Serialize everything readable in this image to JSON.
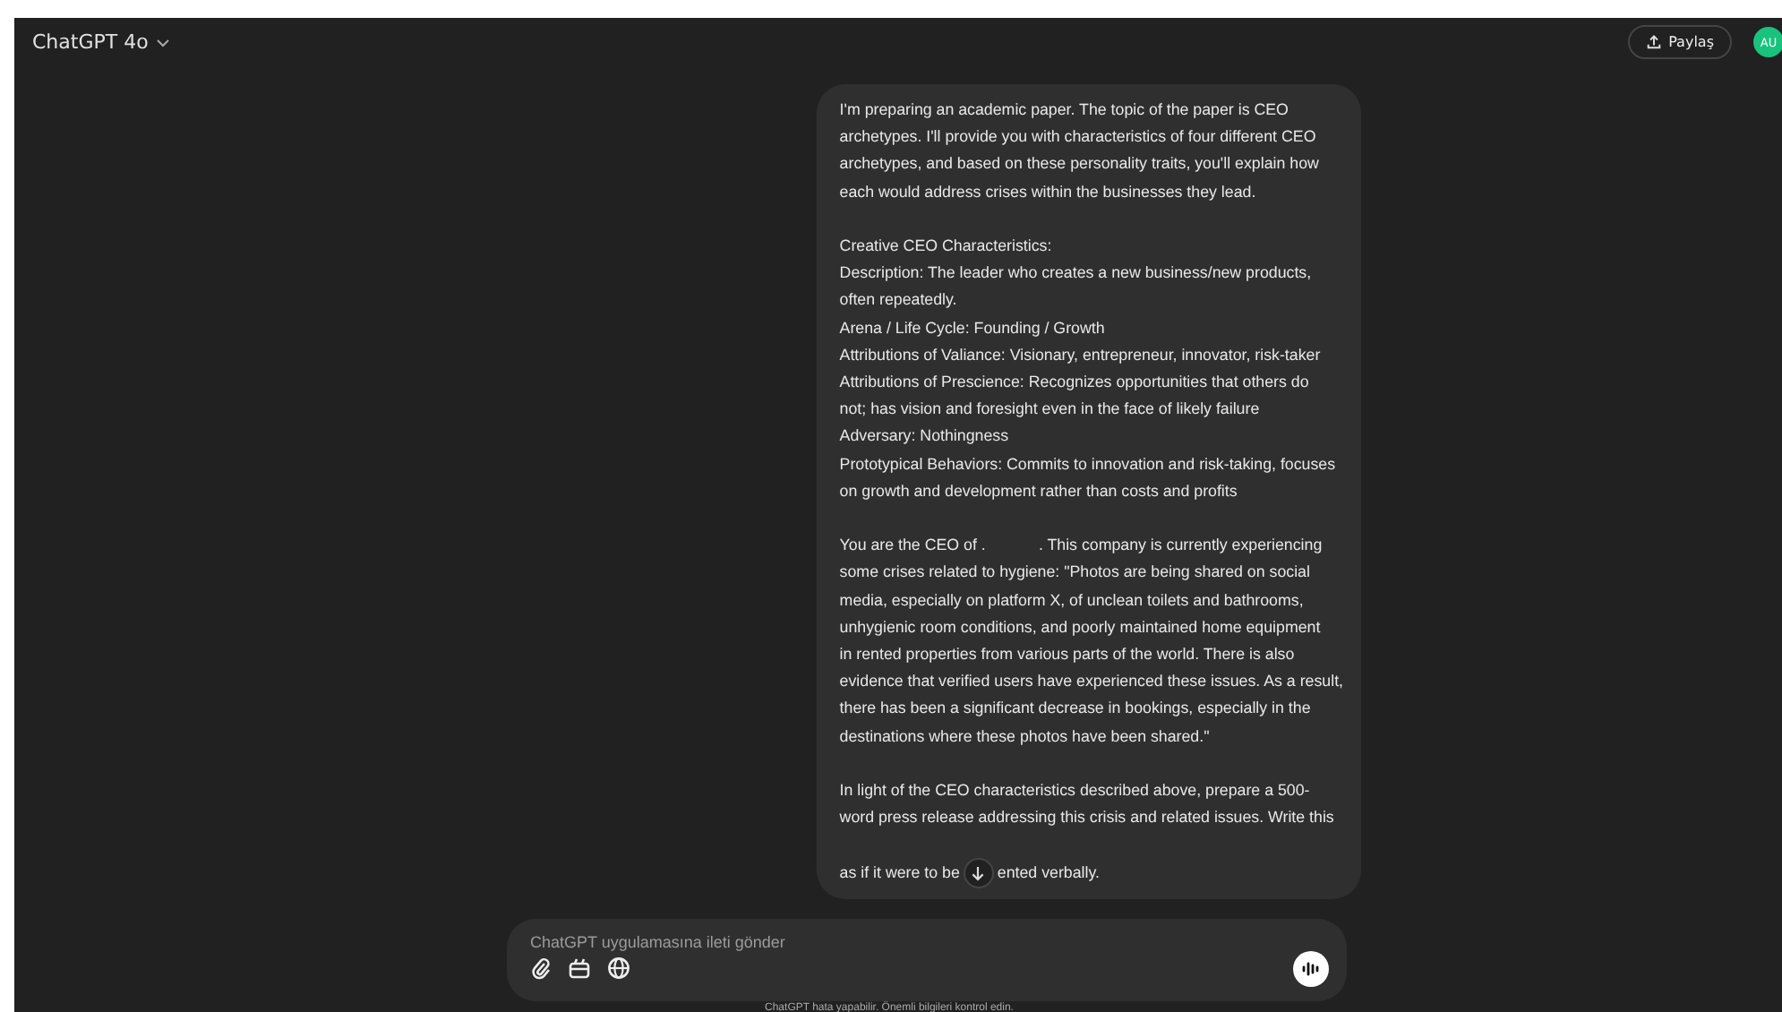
{
  "header": {
    "model": "ChatGPT 4o",
    "share": "Paylaş",
    "avatar": "AU"
  },
  "message": {
    "paragraphs": [
      [
        "I'm preparing an academic paper. The topic of the paper is CEO",
        "archetypes. I'll provide you with characteristics of four different CEO",
        "archetypes, and based on these personality traits, you'll explain how",
        "each would address crises within the businesses they lead."
      ],
      [
        "Creative CEO Characteristics:",
        "Description: The leader who creates a new business/new products,",
        "often repeatedly.",
        "Arena / Life Cycle: Founding / Growth",
        "Attributions of Valiance: Visionary, entrepreneur, innovator, risk-taker",
        "Attributions of Prescience: Recognizes opportunities that others do",
        "not; has vision and foresight even in the face of likely failure",
        "Adversary: Nothingness",
        "Prototypical Behaviors: Commits to innovation and risk-taking, focuses",
        "on growth and development rather than costs and profits"
      ],
      [
        "You are the CEO of .            . This company is currently experiencing",
        "some crises related to hygiene: \"Photos are being shared on social",
        "media, especially on platform X, of unclean toilets and bathrooms,",
        "unhygienic room conditions, and poorly maintained home equipment",
        "in rented properties from various parts of the world. There is also",
        "evidence that verified users have experienced these issues. As a result,",
        "there has been a significant decrease in bookings, especially in the",
        "destinations where these photos have been shared.\""
      ],
      [
        "In light of the CEO characteristics described above, prepare a 500-",
        "word press release addressing this crisis and related issues. Write this"
      ]
    ],
    "last_line_before": "as if it were to be",
    "last_line_after": "ented verbally."
  },
  "composer": {
    "placeholder": "ChatGPT uygulamasına ileti gönder"
  },
  "footer": "ChatGPT hata yapabilir. Önemli bilgileri kontrol edin."
}
